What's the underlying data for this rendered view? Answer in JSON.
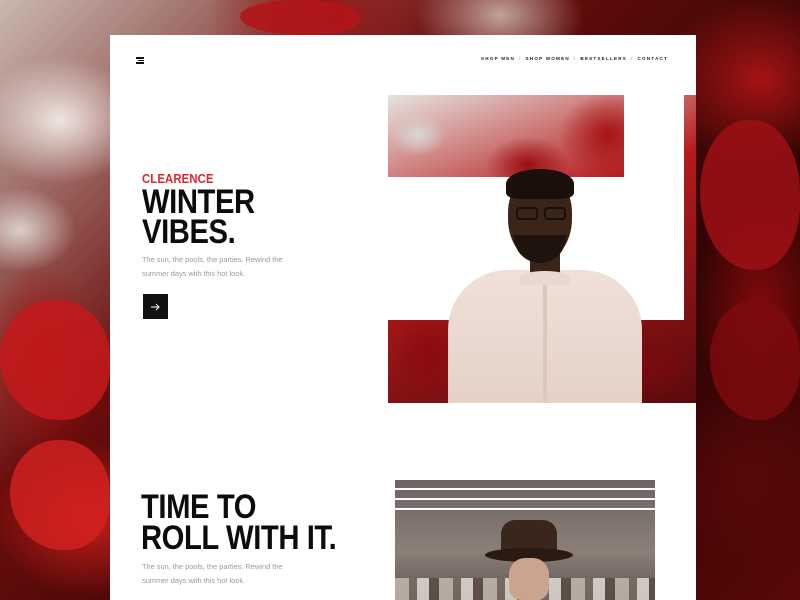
{
  "nav": {
    "items": [
      "SHOP MEN",
      "SHOP WOMEN",
      "BESTSELLERS",
      "CONTACT"
    ],
    "separator": "/"
  },
  "hero": {
    "eyebrow": "CLEARENCE",
    "headline_line1": "WINTER",
    "headline_line2": "VIBES.",
    "description_line1": "The sun, the pools, the parties. Rewind the",
    "description_line2": "summer days with this hot look.",
    "button_icon": "arrow-right-icon"
  },
  "section2": {
    "headline_line1": "TIME TO",
    "headline_line2": "ROLL WITH IT.",
    "description_line1": "The sun, the pools, the parties. Rewind the",
    "description_line2": "summer days with this hot look."
  },
  "colors": {
    "accent": "#e3232c",
    "text": "#0c0c0c",
    "muted": "#9a9a9a",
    "button": "#111111"
  }
}
